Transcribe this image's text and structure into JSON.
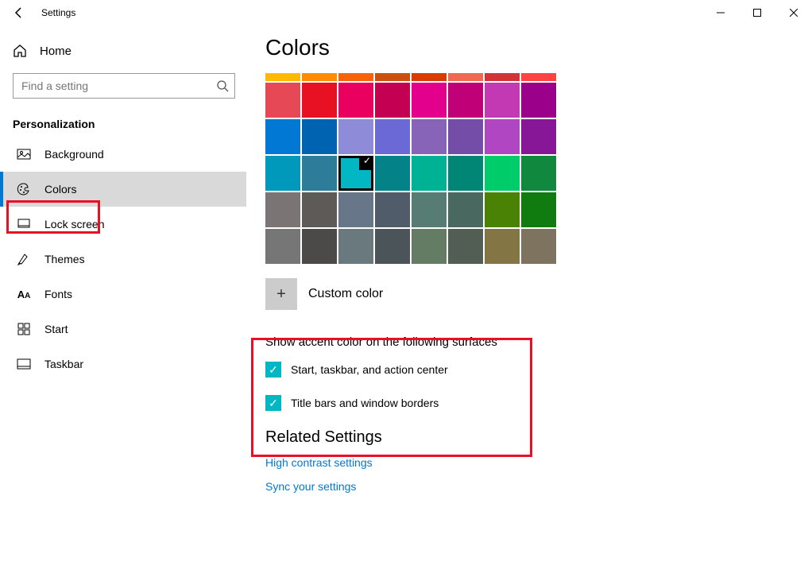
{
  "titlebar": {
    "title": "Settings"
  },
  "sidebar": {
    "home": "Home",
    "search_placeholder": "Find a setting",
    "section": "Personalization",
    "items": [
      {
        "label": "Background"
      },
      {
        "label": "Colors"
      },
      {
        "label": "Lock screen"
      },
      {
        "label": "Themes"
      },
      {
        "label": "Fonts"
      },
      {
        "label": "Start"
      },
      {
        "label": "Taskbar"
      }
    ]
  },
  "content": {
    "title": "Colors",
    "custom_color": "Custom color",
    "surfaces_heading": "Show accent color on the following surfaces",
    "cb1": "Start, taskbar, and action center",
    "cb2": "Title bars and window borders",
    "related_title": "Related Settings",
    "link1": "High contrast settings",
    "link2": "Sync your settings"
  },
  "palette_thin": [
    "#ffb900",
    "#ff8c00",
    "#f7630c",
    "#ca5010",
    "#da3b01",
    "#ef6950",
    "#d13438",
    "#ff4343"
  ],
  "palette": [
    [
      "#e74856",
      "#e81123",
      "#ea005e",
      "#c30052",
      "#e3008c",
      "#bf0077",
      "#c239b3",
      "#9a0089"
    ],
    [
      "#0078d4",
      "#0063b1",
      "#8e8cd8",
      "#6b69d6",
      "#8764b8",
      "#744da9",
      "#b146c2",
      "#881798"
    ],
    [
      "#0099bc",
      "#2d7d9a",
      "#00b7c3",
      "#038387",
      "#00b294",
      "#018574",
      "#00cc6a",
      "#10893e"
    ],
    [
      "#7a7574",
      "#5d5a58",
      "#68768a",
      "#515c6b",
      "#567c73",
      "#486860",
      "#498205",
      "#107c10"
    ],
    [
      "#767676",
      "#4c4a48",
      "#69797e",
      "#4a5459",
      "#647c64",
      "#525e54",
      "#847545",
      "#7e735f"
    ]
  ],
  "selected": {
    "row": 2,
    "col": 2
  }
}
